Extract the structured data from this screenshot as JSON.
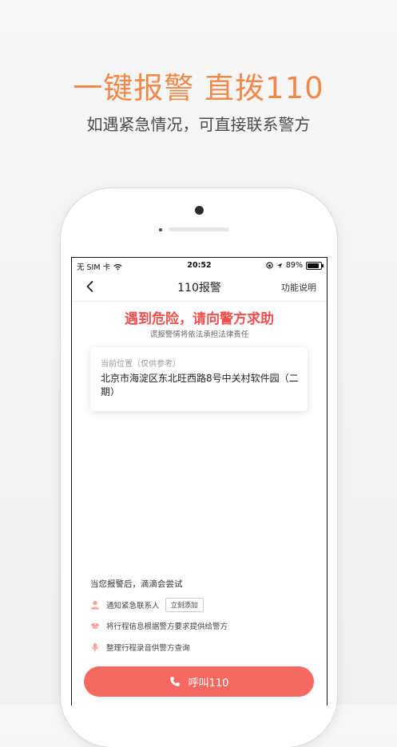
{
  "promo": {
    "headline": "一键报警 直拨110",
    "subline": "如遇紧急情况，可直接联系警方"
  },
  "status_bar": {
    "carrier": "无 SIM 卡",
    "time": "20:52",
    "battery": "89%",
    "battery_level": 0.89
  },
  "nav": {
    "title": "110报警",
    "help": "功能说明"
  },
  "alert": {
    "title": "遇到危险，请向警方求助",
    "warning": "谎报警情将依法承担法律责任"
  },
  "location": {
    "label": "当前位置（仅供参考）",
    "address": "北京市海淀区东北旺西路8号中关村软件园（二期）"
  },
  "after_call": {
    "heading": "当您报警后，滴滴会尝试",
    "items": [
      {
        "icon": "person-icon",
        "text": "通知紧急联系人",
        "button": "立刻添加"
      },
      {
        "icon": "police-cap-icon",
        "text": "将行程信息根据警方要求提供给警方"
      },
      {
        "icon": "microphone-icon",
        "text": "整理行程录音供警方查询"
      }
    ]
  },
  "call_button": {
    "label": "呼叫110",
    "icon": "phone-icon"
  },
  "colors": {
    "promo_orange": "#f2894a",
    "alert_red": "#f0514e",
    "button_red": "#f46a63",
    "icon_pink": "#f4a19c"
  }
}
